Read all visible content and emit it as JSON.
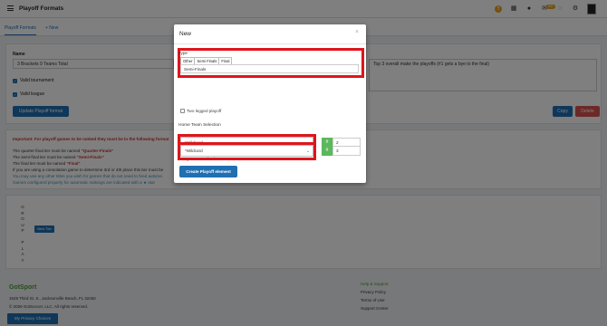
{
  "header": {
    "title": "Playoff Formats",
    "mail_badge": "99+",
    "icons": [
      "help-icon",
      "grid-icon",
      "user-icon",
      "mail-icon",
      "chat-icon",
      "gear-icon",
      "avatar"
    ]
  },
  "subnav": {
    "breadcrumb": "Playoff Formats",
    "new_link": "+ New"
  },
  "form": {
    "name_label": "Name",
    "name_value": "3 Brackets 9 Teams Total",
    "description_value": "Top 3 overall make the playoffs (#1 gets a bye to the final)",
    "valid_tournament_label": "Valid tournament",
    "valid_league_label": "Valid league",
    "update_button": "Update Playoff format",
    "copy_button": "Copy",
    "delete_button": "Delete"
  },
  "notes": {
    "important": "Important: For playoff games to be ranked they must be in the following format",
    "quarter_prefix": "The quarter-final tier must be named ",
    "quarter_name": "\"Quarter-Finals\"",
    "semi_prefix": "The semi-final tier must be named ",
    "semi_name": "\"Semi-Finals\"",
    "final_prefix": "The final tier must be named ",
    "final_name": "\"Final\"",
    "consolation": "If you are using a consolation game to determine 3rd or 4th place this tier must be",
    "other_games": "You may use any other titles you wish for games that do not need to feed automa",
    "auto_rank": "Games configured properly for automatic rankings are indicated with a ★ star"
  },
  "group": {
    "letters": [
      "G",
      "R",
      "O",
      "U",
      "P",
      "",
      "P",
      "L",
      "A",
      "Y"
    ],
    "new_tier_button": "New Tier"
  },
  "footer": {
    "logo": "GotSport",
    "address": "1529 Third St. S., Jacksonville Beach, FL 32250",
    "copyright": "© 2026 GotSoccer, LLC. All rights reserved.",
    "help_heading": "Help & Support",
    "privacy_policy": "Privacy Policy",
    "terms": "Terms of Use",
    "support_center": "Support Center",
    "privacy_choices_button": "My Privacy Choices"
  },
  "modal": {
    "title": "New",
    "close": "×",
    "type_label": "Type",
    "type_options": [
      "Other",
      "Semi Finals",
      "Final"
    ],
    "type_value": "Semi-Finals",
    "two_legged_label": "Two legged playoff",
    "home_label": "Home Team Selection",
    "home_select_value": "*Wildcard",
    "home_hash": "#",
    "home_number": "2",
    "away_label": "Away Team Selection",
    "away_select_value": "*Wildcard",
    "away_hash": "#",
    "away_number": "3",
    "create_button": "Create Playoff element"
  },
  "colors": {
    "primary": "#1f6fb2",
    "danger": "#d9534f",
    "highlight": "#e0141b",
    "hash_green": "#5cb85c"
  }
}
